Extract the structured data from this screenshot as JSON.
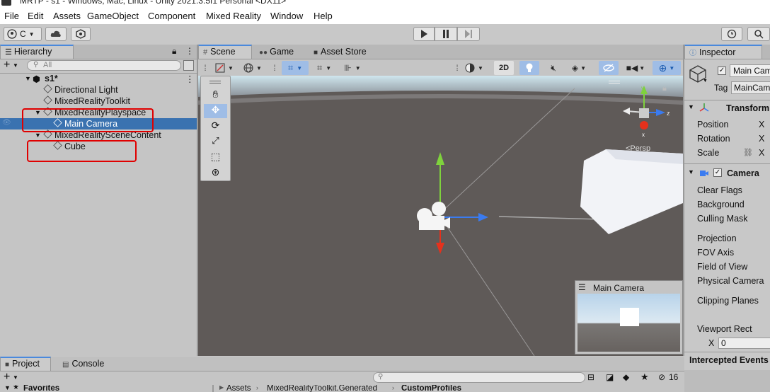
{
  "window": {
    "title": "MRTP - s1 - Windows, Mac, Linux - Unity 2021.3.5f1 Personal <DX11>"
  },
  "menu": [
    "File",
    "Edit",
    "Assets",
    "GameObject",
    "Component",
    "Mixed Reality",
    "Window",
    "Help"
  ],
  "toolbar": {
    "account_label": "C"
  },
  "hierarchy": {
    "tab": "Hierarchy",
    "search_placeholder": "All",
    "scene_name": "s1*",
    "items": [
      {
        "label": "Directional Light"
      },
      {
        "label": "MixedRealityToolkit"
      },
      {
        "label": "MixedRealityPlayspace"
      },
      {
        "label": "Main Camera"
      },
      {
        "label": "MixedRealitySceneContent"
      },
      {
        "label": "Cube"
      }
    ]
  },
  "scene_tabs": [
    "Scene",
    "Game",
    "Asset Store"
  ],
  "scene_toolbar": {
    "mode_2d": "2D"
  },
  "scene_view": {
    "persp_label": "<Persp",
    "camera_preview_title": "Main Camera",
    "gizmo_x": "x",
    "gizmo_z": "z",
    "gizmo_y": "y"
  },
  "inspector": {
    "tab": "Inspector",
    "object_name": "Main Cam",
    "tag_label": "Tag",
    "tag_value": "MainCam",
    "transform": {
      "title": "Transform",
      "rows": [
        "Position",
        "Rotation",
        "Scale"
      ],
      "axis": "X"
    },
    "camera": {
      "title": "Camera",
      "rows": [
        "Clear Flags",
        "Background",
        "Culling Mask",
        "Projection",
        "FOV Axis",
        "Field of View",
        "Physical Camera",
        "Clipping Planes",
        "Viewport Rect"
      ]
    },
    "viewport_x_label": "X",
    "viewport_x_value": "0",
    "intercepted_events": "Intercepted Events"
  },
  "bottom": {
    "tabs": [
      "Project",
      "Console"
    ],
    "favorites": "Favorites",
    "breadcrumb": [
      "Assets",
      "MixedRealityToolkit.Generated",
      "CustomProfiles"
    ],
    "hidden_count": "16"
  },
  "colors": {
    "selection": "#3a72b0",
    "highlight_box": "#e00000",
    "accent_blue": "#4a89dc"
  }
}
